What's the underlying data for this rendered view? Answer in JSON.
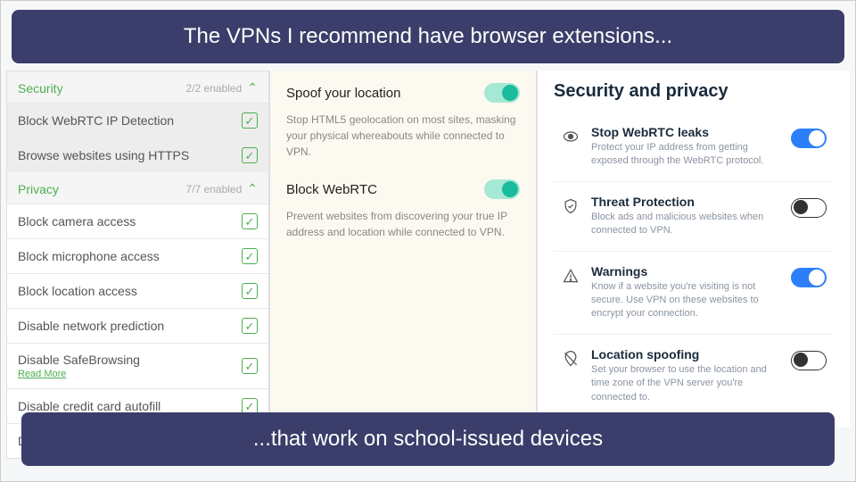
{
  "banner_top": "The VPNs I recommend have browser extensions...",
  "banner_bottom": "...that work on school-issued devices",
  "col1": {
    "security": {
      "title": "Security",
      "count": "2/2 enabled",
      "items": [
        "Block WebRTC IP Detection",
        "Browse websites using HTTPS"
      ]
    },
    "privacy": {
      "title": "Privacy",
      "count": "7/7 enabled",
      "items": [
        "Block camera access",
        "Block microphone access",
        "Block location access",
        "Disable network prediction",
        "Disable SafeBrowsing",
        "Disable credit card autofill",
        "Disable address autofill"
      ],
      "readmore": "Read More"
    }
  },
  "col2": {
    "spoof": {
      "title": "Spoof your location",
      "desc": "Stop HTML5 geolocation on most sites, masking your physical whereabouts while connected to VPN."
    },
    "webrtc": {
      "title": "Block WebRTC",
      "desc": "Prevent websites from discovering your true IP address and location while connected to VPN."
    }
  },
  "col3": {
    "title": "Security and privacy",
    "items": [
      {
        "label": "Stop WebRTC leaks",
        "desc": "Protect your IP address from getting exposed through the WebRTC protocol.",
        "on": true,
        "icon": "eye"
      },
      {
        "label": "Threat Protection",
        "desc": "Block ads and malicious websites when connected to VPN.",
        "on": false,
        "icon": "shield"
      },
      {
        "label": "Warnings",
        "desc": "Know if a website you're visiting is not secure. Use VPN on these websites to encrypt your connection.",
        "on": true,
        "icon": "warning"
      },
      {
        "label": "Location spoofing",
        "desc": "Set your browser to use the location and time zone of the VPN server you're connected to.",
        "on": false,
        "icon": "location"
      }
    ]
  }
}
